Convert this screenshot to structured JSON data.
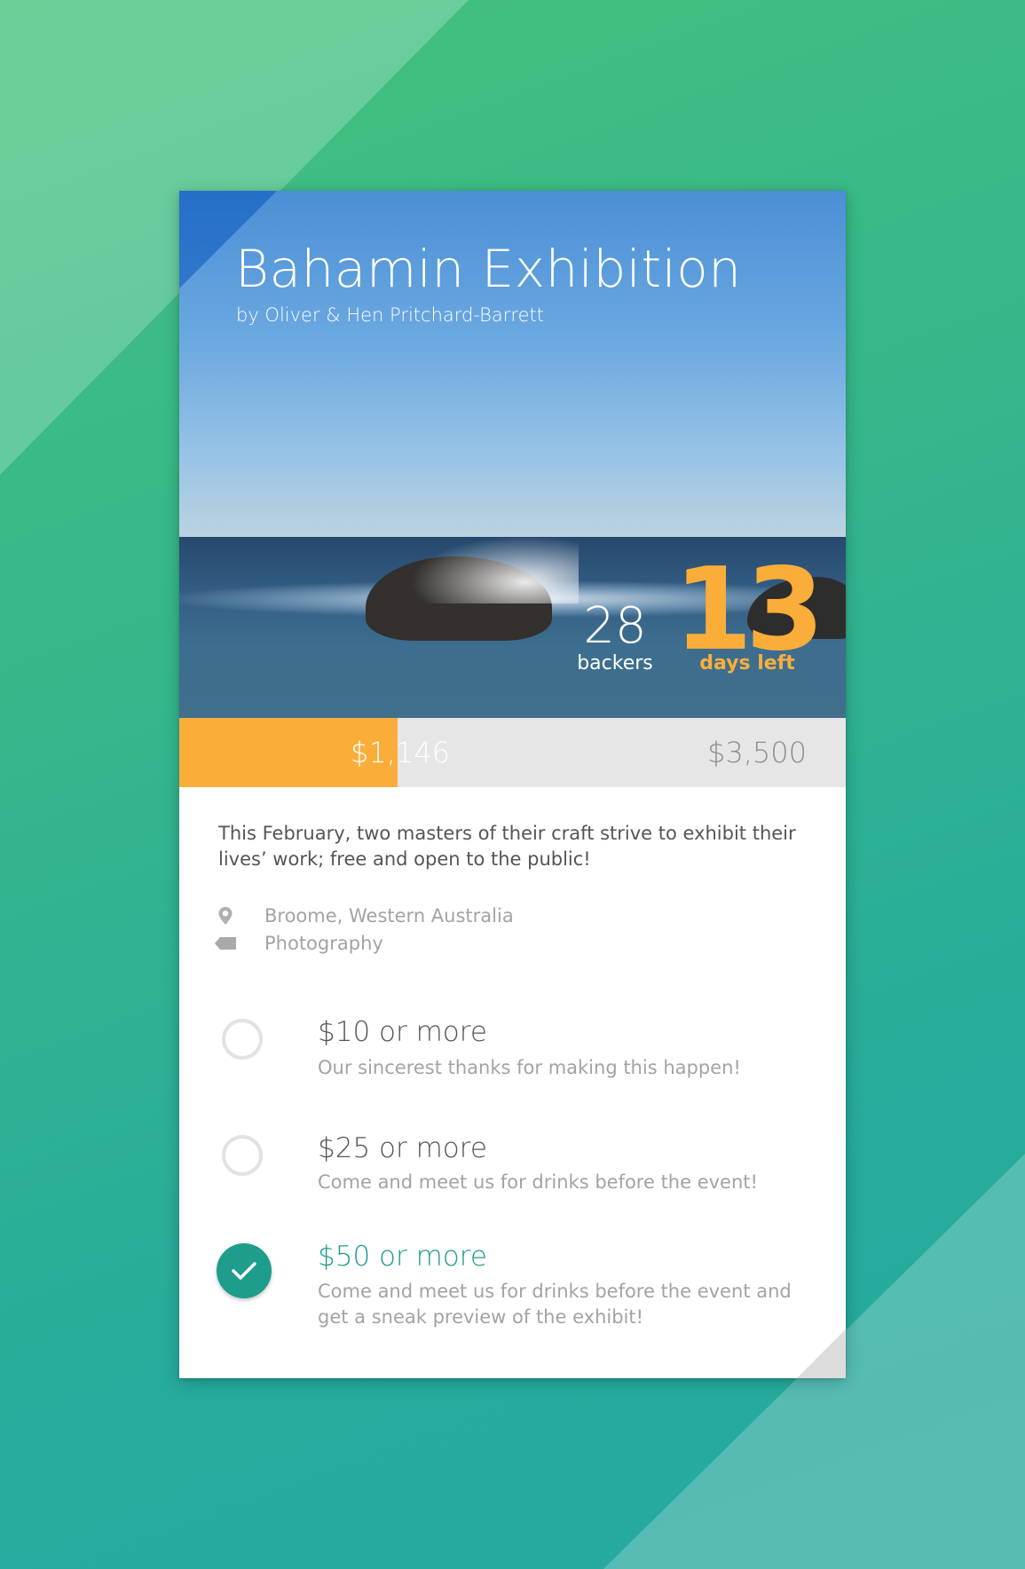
{
  "project": {
    "title": "Bahamin Exhibition",
    "creators": "by Oliver & Hen Pritchard-Barrett",
    "backers_count": "28",
    "backers_label": "backers",
    "days_left_count": "13",
    "days_left_label": "days left"
  },
  "funding": {
    "raised": "$1,146",
    "goal": "$3,500",
    "progress_fraction": 0.327
  },
  "details": {
    "description": "This February, two masters of their craft strive to exhibit their lives’ work; free and open to the public!",
    "location": "Broome, Western Australia",
    "category": "Photography",
    "location_icon": "location-pin-icon",
    "category_icon": "tag-icon"
  },
  "rewards": [
    {
      "title": "$10 or more",
      "description": "Our sincerest thanks for making this happen!",
      "selected": false
    },
    {
      "title": "$25 or more",
      "description": "Come and meet us for drinks before the event!",
      "selected": false
    },
    {
      "title": "$50 or more",
      "description": "Come and meet us for drinks before the event and get a sneak preview of the exhibit!",
      "selected": true
    }
  ],
  "colors": {
    "accent_orange": "#fbad3a",
    "accent_teal": "#1e9c8c",
    "background_green": "#43c27c",
    "background_teal": "#27aa9f"
  }
}
